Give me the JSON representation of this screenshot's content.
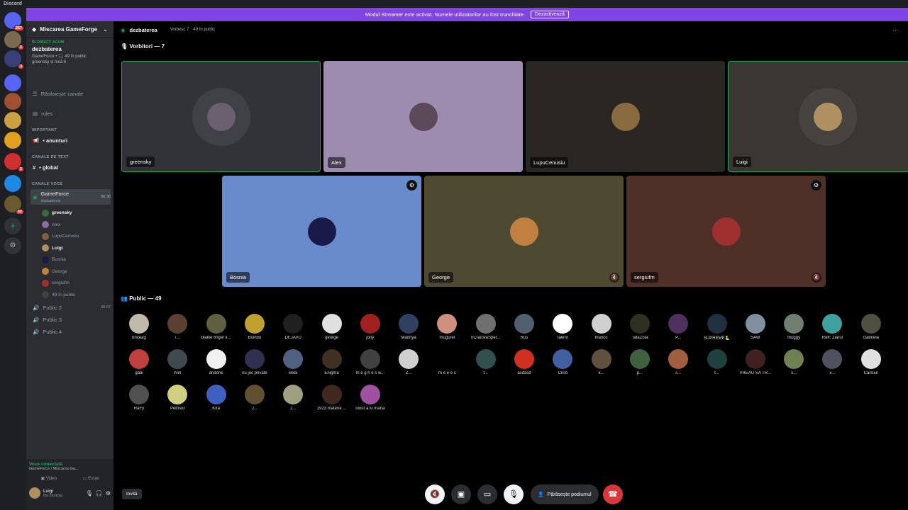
{
  "titlebar": "Discord",
  "banner": {
    "text": "Modul Streamer este activat. Numele utilizatorilor au fost trunchiate.",
    "button": "Dezactivează"
  },
  "guilds": [
    {
      "c": "#5865f2",
      "b": "267"
    },
    {
      "c": "#7a6a50",
      "b": "2"
    },
    {
      "c": "#3b3f7a",
      "b": "3"
    },
    {
      "c": "#5865f2",
      "b": ""
    },
    {
      "c": "#a05030",
      "b": ""
    },
    {
      "c": "#caa040",
      "b": ""
    },
    {
      "c": "#e0a020",
      "b": ""
    },
    {
      "c": "#d03030",
      "b": "2"
    },
    {
      "c": "#1e88e5",
      "b": ""
    },
    {
      "c": "#6a5a30",
      "b": "32"
    }
  ],
  "sidebar": {
    "server": "Miscarea GameForge",
    "live_label": "ÎN DIRECT ACUM",
    "live_title": "dezbaterea",
    "live_meta": "GameForce • 🎧 49 în public",
    "live_users": "greensky și încă 6",
    "browse": "Răsfoiește canale",
    "rules": "rules",
    "cat_important": "IMPORTANT",
    "anunturi": "• anunturi",
    "cat_text": "CANALE DE TEXT",
    "global": "• global",
    "cat_voice": "CANALE VOCE",
    "gameforce": "GameForce",
    "gameforce_sub": "dezbaterea",
    "gameforce_count": "56 30",
    "voice_users": [
      "greensky",
      "Alex",
      "LupuCenusiu",
      "Luigi",
      "Bosnia",
      "George",
      "sergiufm",
      "49 în public"
    ],
    "publics": [
      {
        "name": "Public 2",
        "count": "00 07"
      },
      {
        "name": "Public 3",
        "count": ""
      },
      {
        "name": "Public 4",
        "count": ""
      }
    ],
    "voice_connected": "Voce conectată",
    "voice_path": "GameForce / Miscarea Ga...",
    "video": "Video",
    "screen": "Ecran",
    "user": "Luigi",
    "user_status": "Nu deranja"
  },
  "topbar": {
    "channel": "dezbaterea",
    "speakers": "Vorbesc 7",
    "public": "49 în public"
  },
  "speakers_label": "Vorbitori — 7",
  "public_label": "Public — 49",
  "speakers": [
    {
      "name": "greensky",
      "bg": "#313338",
      "av": "#6a6070",
      "mod": false,
      "mute": false,
      "active": true
    },
    {
      "name": "Alex",
      "bg": "#9e8bb0",
      "av": "#5a4a5a",
      "mod": false,
      "mute": false,
      "active": false
    },
    {
      "name": "LupuCenusiu",
      "bg": "#2a2622",
      "av": "#8a6a40",
      "mod": false,
      "mute": false,
      "active": false
    },
    {
      "name": "Luigi",
      "bg": "#3a3632",
      "av": "#b09060",
      "mod": false,
      "mute": false,
      "active": true
    },
    {
      "name": "Bosnia",
      "bg": "#6a8bcb",
      "av": "#1a1a4a",
      "mod": true,
      "mute": false,
      "active": false
    },
    {
      "name": "George",
      "bg": "#4e4a32",
      "av": "#c08040",
      "mod": false,
      "mute": true,
      "active": false
    },
    {
      "name": "sergiufm",
      "bg": "#4e3028",
      "av": "#a03030",
      "mod": true,
      "mute": true,
      "active": false
    }
  ],
  "audience": [
    [
      "briceag",
      "#c0b8a8"
    ],
    [
      "i...",
      "#5a4030"
    ],
    [
      "blakie finger li...",
      "#606040"
    ],
    [
      "Biondu",
      "#c0a030"
    ],
    [
      "DEJAVU",
      "#202020"
    ],
    [
      "george",
      "#e0e0e0"
    ],
    [
      "jony",
      "#a02020"
    ],
    [
      "Madriya",
      "#304060"
    ],
    [
      "mugurel",
      "#d09080"
    ],
    [
      "nCraiovaSper...",
      "#707070"
    ],
    [
      "Rus",
      "#506070"
    ],
    [
      "talent",
      "#ffffff"
    ],
    [
      "thanos",
      "#d0d0d0"
    ],
    [
      "TataZoia",
      "#303020"
    ],
    [
      "P...",
      "#503060"
    ],
    [
      "SUPREME🐍",
      "#203040"
    ],
    [
      "SAW",
      "#8090a0"
    ],
    [
      "thuggy",
      "#708070"
    ],
    [
      "Reff: Ziarul",
      "#40a0a0"
    ],
    [
      "Gabriela",
      "#505040"
    ],
    [
      "-V",
      "#404040"
    ],
    [
      "gabi",
      "#c04040"
    ],
    [
      "Alin",
      "#404850"
    ],
    [
      "andone",
      "#f0f0f0"
    ],
    [
      "nu joc private",
      "#303050"
    ],
    [
      "Bebi",
      "#506080"
    ],
    [
      "Enigma",
      "#403020"
    ],
    [
      "m e g h e s w...",
      "#404040"
    ],
    [
      "Z...",
      "#d0d0d0"
    ],
    [
      "m e e e c",
      "#000000"
    ],
    [
      "t...",
      "#305050"
    ],
    [
      "asdasd",
      "#d03020"
    ],
    [
      "Cristi",
      "#4060a0"
    ],
    [
      "k...",
      "#605040"
    ],
    [
      "p...",
      "#406040"
    ],
    [
      "s...",
      "#a06040"
    ],
    [
      "t...",
      "#204040"
    ],
    [
      "VREAU SA TR...",
      "#402020"
    ],
    [
      "x...",
      "#708050"
    ],
    [
      "x...",
      "#505060"
    ],
    [
      "Cariciul",
      "#e0e0e0"
    ],
    [
      "Darius",
      "#506070"
    ],
    [
      "RaFy",
      "#505050"
    ],
    [
      "Petrisor",
      "#d0d080"
    ],
    [
      "Kira",
      "#4060c0"
    ],
    [
      "J...",
      "#605030"
    ],
    [
      "J...",
      "#a0a080"
    ],
    [
      "1923 materie ...",
      "#402820"
    ],
    [
      "ionut a lu maria",
      "#a050a0"
    ]
  ],
  "controls": {
    "leave": "Părăsește podiumul",
    "invite": "Invită"
  }
}
